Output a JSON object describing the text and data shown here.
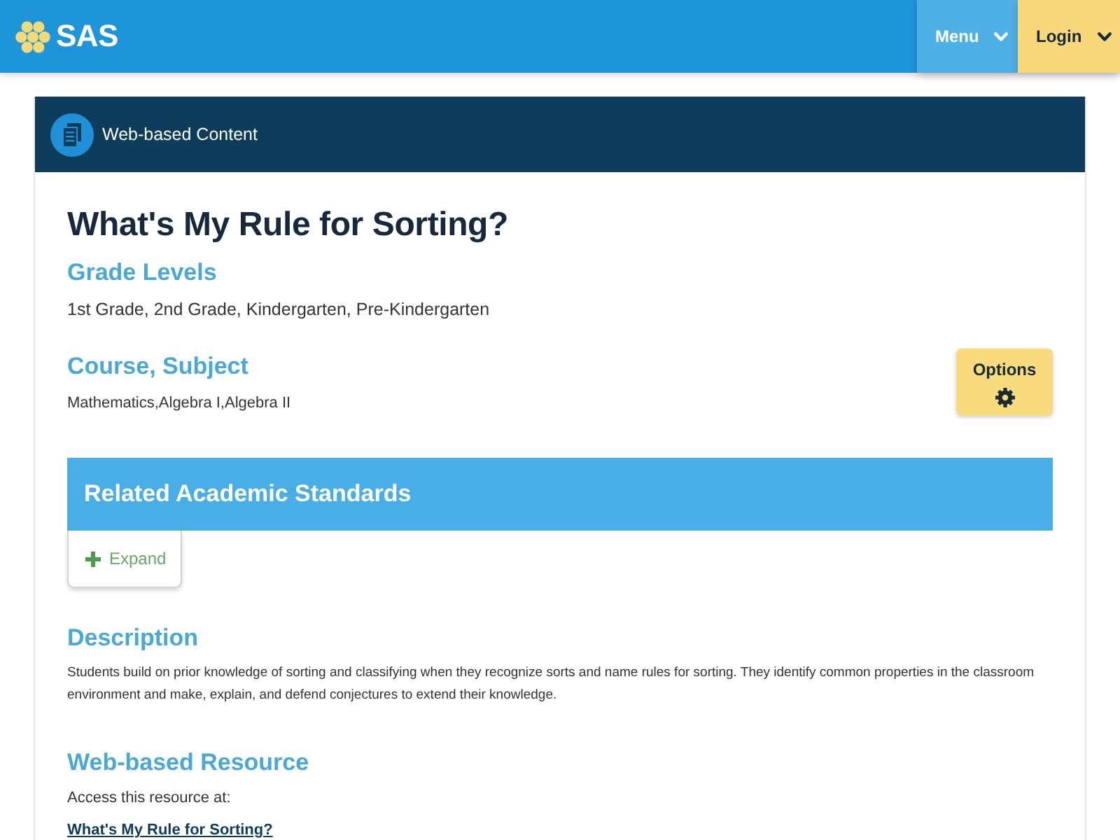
{
  "header": {
    "logo": "SAS",
    "nav": [
      {
        "label": "Menu",
        "kind": "menu"
      },
      {
        "label": "Login",
        "kind": "login"
      }
    ]
  },
  "card": {
    "type_label": "Web-based Content",
    "title": "What's My Rule for Sorting?",
    "grade_levels": {
      "heading": "Grade Levels",
      "value": "1st Grade, 2nd Grade, Kindergarten, Pre-Kindergarten"
    },
    "course_subject": {
      "heading": "Course, Subject",
      "value": "Mathematics,Algebra I,Algebra II"
    },
    "options_button": {
      "label": "Options"
    },
    "standards": {
      "heading": "Related Academic Standards",
      "toggle": "Expand",
      "expanded": false
    },
    "description": {
      "heading": "Description",
      "text": "Students build on prior knowledge of sorting and classifying when they recognize sorts and name rules for sorting. They identify common properties in the classroom environment and make, explain, and defend conjectures to extend their knowledge."
    },
    "resource": {
      "heading": "Web-based Resource",
      "intro": "Access this resource at:",
      "link": "What's My Rule for Sorting?"
    }
  }
}
